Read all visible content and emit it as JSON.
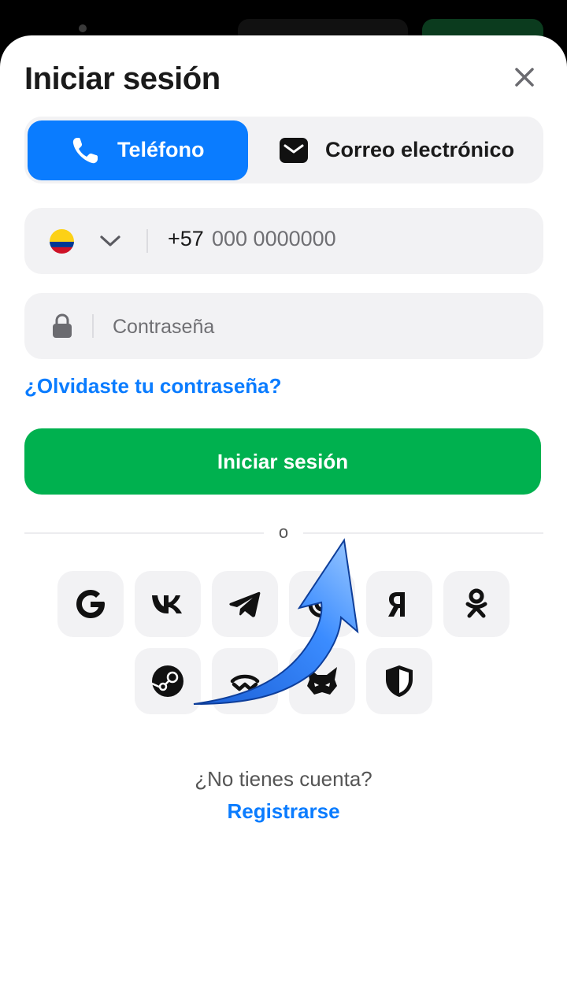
{
  "modal": {
    "title": "Iniciar sesión",
    "close_icon": "close-icon"
  },
  "tabs": [
    {
      "label": "Teléfono",
      "icon": "phone-icon",
      "active": true
    },
    {
      "label": "Correo electrónico",
      "icon": "mail-icon",
      "active": false
    }
  ],
  "phone_field": {
    "country_flag": "colombia-flag",
    "country_code": "+57",
    "placeholder": "000 0000000"
  },
  "password_field": {
    "icon": "lock-icon",
    "placeholder": "Contraseña"
  },
  "forgot_link": "¿Olvidaste tu contraseña?",
  "login_button": "Iniciar sesión",
  "divider_text": "o",
  "social_logins": [
    {
      "name": "google",
      "icon": "google-icon"
    },
    {
      "name": "vk",
      "icon": "vk-icon"
    },
    {
      "name": "telegram",
      "icon": "telegram-icon"
    },
    {
      "name": "mail-ru",
      "icon": "at-icon"
    },
    {
      "name": "yandex",
      "icon": "yandex-icon"
    },
    {
      "name": "odnoklassniki",
      "icon": "ok-icon"
    },
    {
      "name": "steam",
      "icon": "steam-icon"
    },
    {
      "name": "walletconnect",
      "icon": "walletconnect-icon"
    },
    {
      "name": "metamask",
      "icon": "fox-icon"
    },
    {
      "name": "security",
      "icon": "shield-icon"
    }
  ],
  "signup": {
    "prompt": "¿No tienes cuenta?",
    "link": "Registrarse"
  },
  "colors": {
    "accent_blue": "#0a7cff",
    "login_green": "#00b14f",
    "field_bg": "#f2f2f4"
  }
}
